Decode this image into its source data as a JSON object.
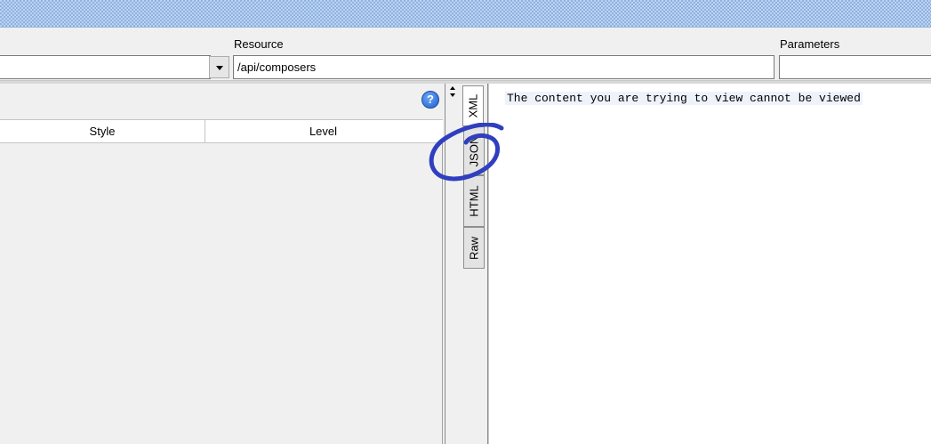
{
  "toolbar": {
    "resource_label": "Resource",
    "resource_value": "/api/composers",
    "parameters_label": "Parameters",
    "parameters_value": ""
  },
  "panel": {
    "help_glyph": "?",
    "columns": [
      "Style",
      "Level"
    ]
  },
  "tabs": [
    {
      "label": "XML",
      "active": true
    },
    {
      "label": "JSON",
      "active": false
    },
    {
      "label": "HTML",
      "active": false
    },
    {
      "label": "Raw",
      "active": false
    }
  ],
  "content": {
    "message": "The content you are trying to view cannot be viewed"
  },
  "annotation": {
    "color": "#2f3fbf",
    "icon": "hand-drawn-circle"
  }
}
